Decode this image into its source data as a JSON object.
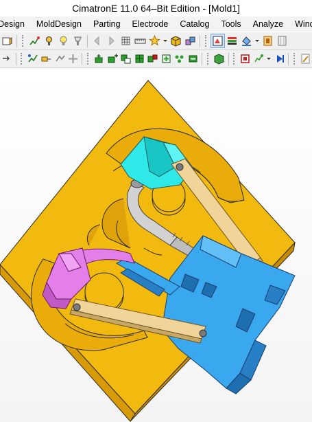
{
  "window": {
    "title": "CimatronE 11.0 64–Bit Edition - [Mold1]"
  },
  "menu": {
    "items": [
      "Design",
      "MoldDesign",
      "Parting",
      "Electrode",
      "Catalog",
      "Tools",
      "Analyze",
      "Window"
    ]
  },
  "toolbar1": {
    "icons": [
      "ortho-view-icon",
      "mold-tree-icon",
      "cavity-icon",
      "bulb-icon",
      "light-icon",
      "arrow-left-icon",
      "arrow-right-icon",
      "grid-icon",
      "ruler-icon",
      "explode-icon",
      "dropdown-icon",
      "box-icon",
      "cubes-icon",
      "render-icon",
      "colors-icon",
      "fill-icon",
      "layer-icon",
      "wire-icon"
    ]
  },
  "toolbar2": {
    "icons": [
      "select-icon",
      "tree-select-icon",
      "link-icon",
      "star-icon",
      "comp-add-icon",
      "comp-remove-icon",
      "comp-move-icon",
      "comp-copy-icon",
      "comp-group-icon",
      "comp-link-icon",
      "comp-edit-icon",
      "shell-icon",
      "fill-icon",
      "blank-icon",
      "blank-show-icon",
      "play-icon",
      "edit-icon"
    ]
  },
  "colors": {
    "plate": "#f2b90f",
    "plate_side": "#d89a06",
    "cyan": "#2fe8e8",
    "blue": "#3aa8ee",
    "magenta": "#e47ee8",
    "arm": "#f0d49a",
    "steel": "#c8c8c8"
  }
}
